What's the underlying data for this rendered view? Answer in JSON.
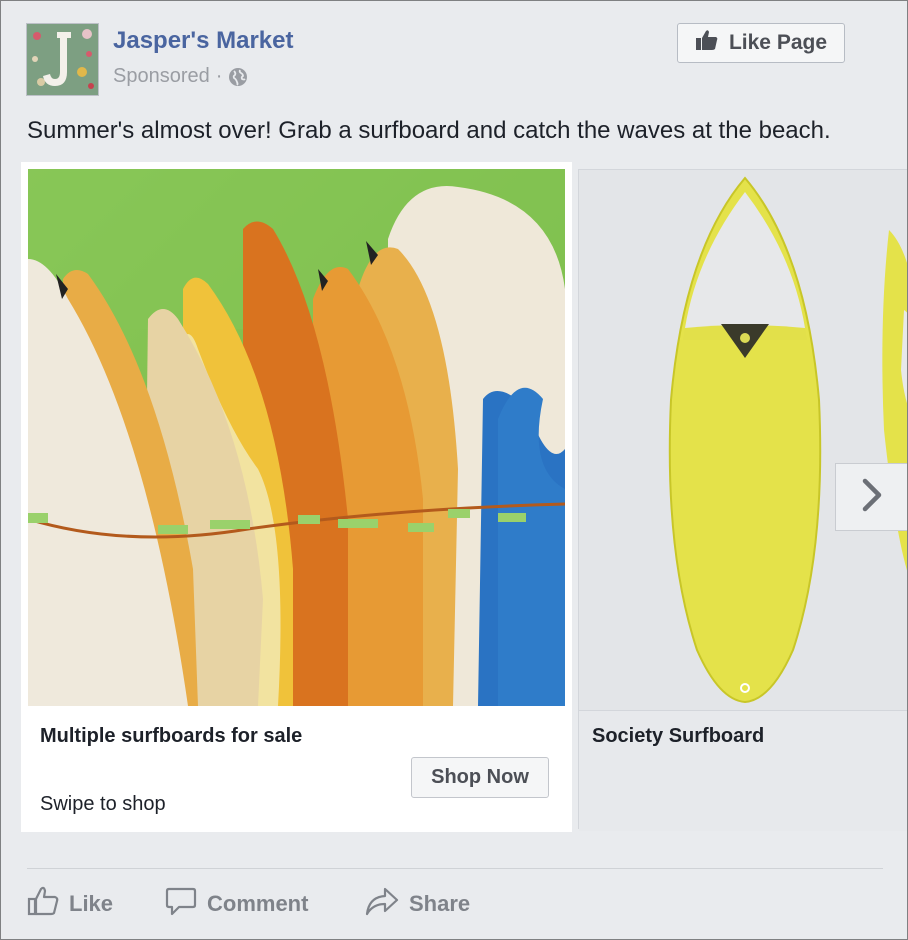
{
  "header": {
    "page_name": "Jasper's Market",
    "sponsored": "Sponsored",
    "separator": "·",
    "like_page_label": "Like Page",
    "avatar_letter": "J"
  },
  "post": {
    "text": "Summer's almost over! Grab a surfboard and catch the waves at the beach."
  },
  "carousel": {
    "cards": [
      {
        "title": "Multiple surfboards for sale",
        "description": "Swipe to shop",
        "cta": "Shop Now"
      },
      {
        "title": "Society Surfboard"
      }
    ]
  },
  "actions": {
    "like": "Like",
    "comment": "Comment",
    "share": "Share"
  },
  "icons": {
    "globe": "globe-icon",
    "thumb": "thumbs-up-icon",
    "comment": "comment-icon",
    "share": "share-icon",
    "next": "chevron-right-icon"
  },
  "colors": {
    "brand_link": "#4a65a0",
    "secondary_text": "#9a9da3",
    "button_text": "#4c4f56",
    "action_text": "#7f838a"
  }
}
